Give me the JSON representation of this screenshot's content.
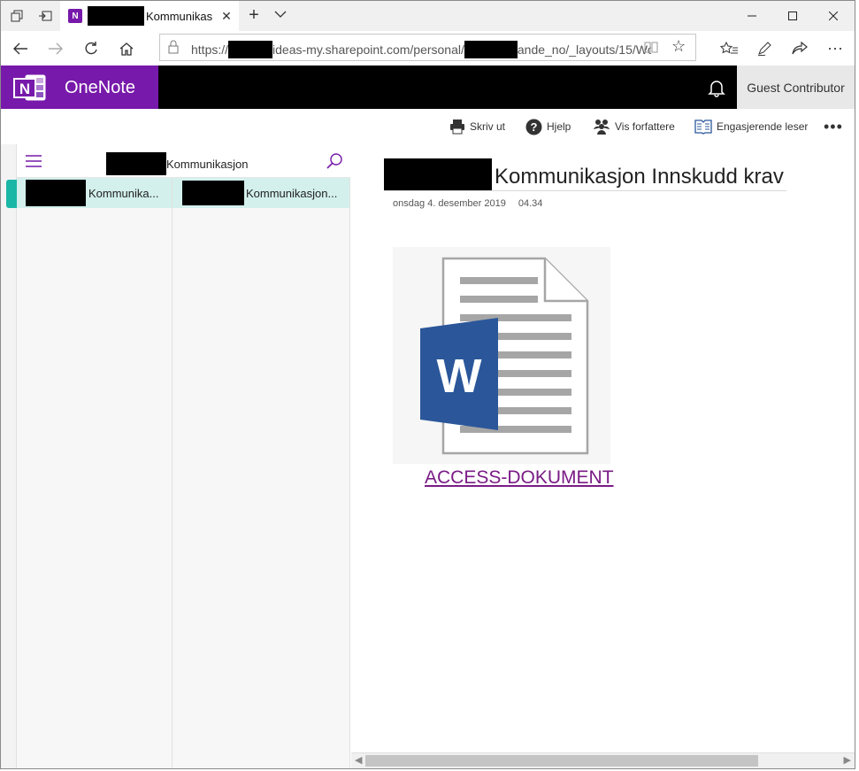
{
  "browser": {
    "tab": {
      "title": "Kommunikas"
    },
    "address": {
      "url_prefix": "https://",
      "url_middle": "ideas-my.sharepoint.com/personal/",
      "url_suffix": "ande_no/_layouts/15/Wo"
    }
  },
  "onenote": {
    "app_name": "OneNote",
    "user": "Guest Contributor",
    "commands": {
      "print": "Skriv ut",
      "help": "Hjelp",
      "authors": "Vis forfattere",
      "reader": "Engasjerende leser"
    },
    "notebook": {
      "title": "Kommunikasjon"
    },
    "section": {
      "label": "Kommunika..."
    },
    "page_item": {
      "label": "Kommunikasjon..."
    },
    "page": {
      "title": "Kommunikasjon Innskudd krav",
      "date": "onsdag 4. desember 2019",
      "time": "04.34",
      "attachment": {
        "label": "ACCESS-DOKUMENT",
        "icon": "word-document-icon"
      }
    }
  },
  "colors": {
    "brand": "#7719aa",
    "section_accent": "#1ab6a6",
    "selected_row": "#d3f0ec",
    "link": "#7a1c86",
    "word_blue": "#2b579a"
  }
}
